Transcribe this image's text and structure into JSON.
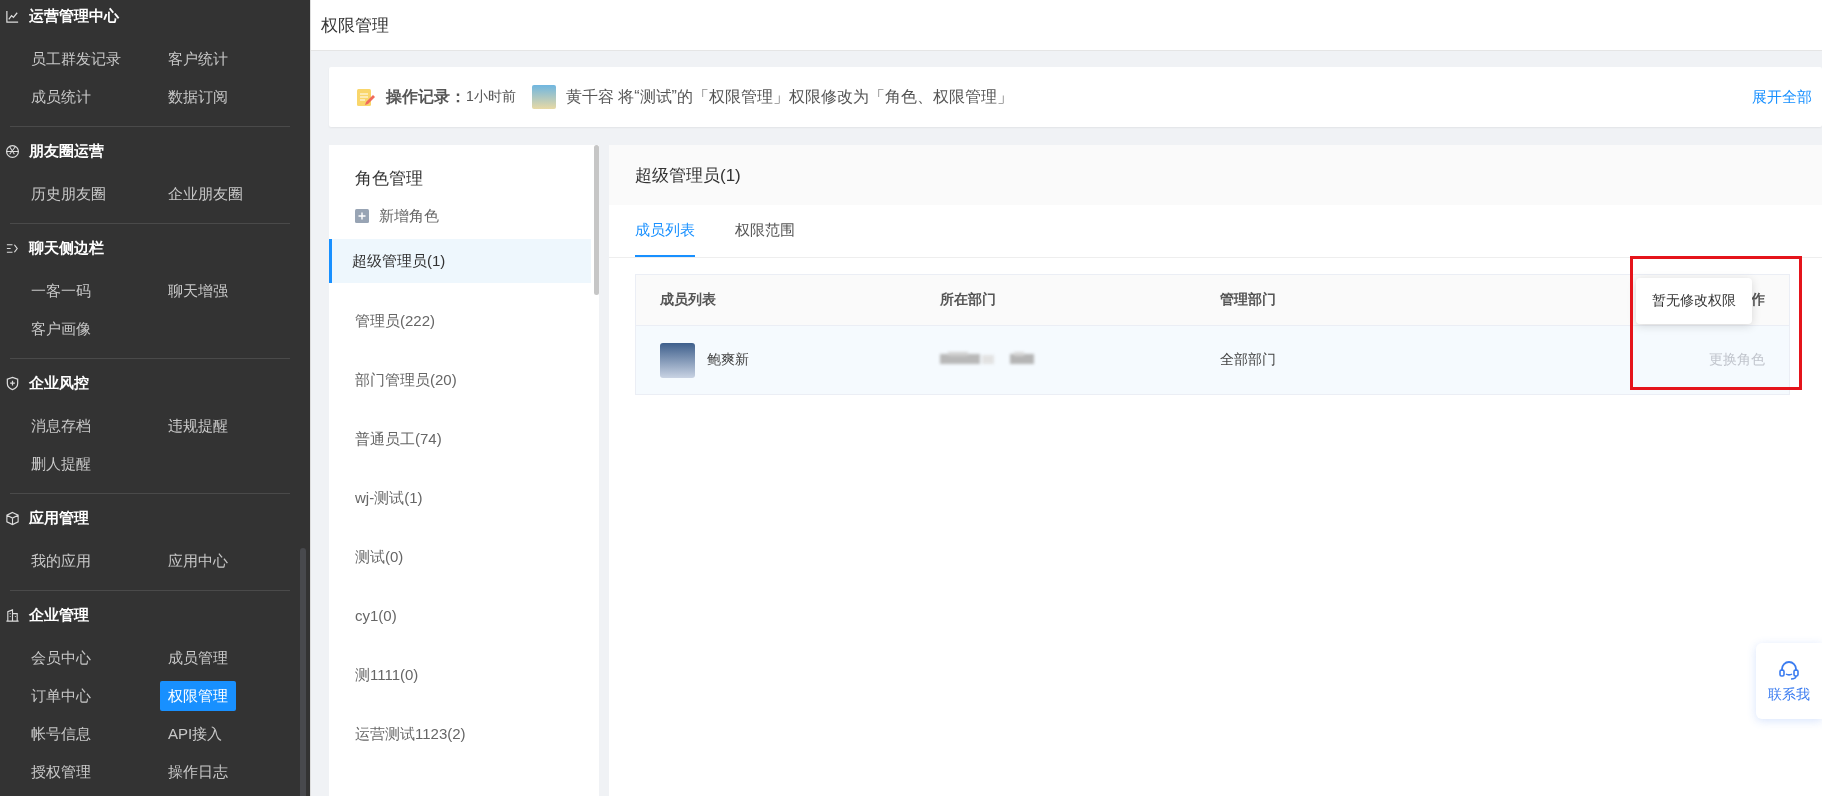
{
  "sidebar": {
    "groups": [
      {
        "title": "运营管理中心",
        "items": [
          {
            "label": "员工群发记录",
            "selected": false
          },
          {
            "label": "客户统计",
            "selected": false
          },
          {
            "label": "成员统计",
            "selected": false
          },
          {
            "label": "数据订阅",
            "selected": false
          }
        ]
      },
      {
        "title": "朋友圈运营",
        "items": [
          {
            "label": "历史朋友圈",
            "selected": false
          },
          {
            "label": "企业朋友圈",
            "selected": false
          }
        ]
      },
      {
        "title": "聊天侧边栏",
        "items": [
          {
            "label": "一客一码",
            "selected": false
          },
          {
            "label": "聊天增强",
            "selected": false
          },
          {
            "label": "客户画像",
            "selected": false
          }
        ]
      },
      {
        "title": "企业风控",
        "items": [
          {
            "label": "消息存档",
            "selected": false
          },
          {
            "label": "违规提醒",
            "selected": false
          },
          {
            "label": "删人提醒",
            "selected": false
          }
        ]
      },
      {
        "title": "应用管理",
        "items": [
          {
            "label": "我的应用",
            "selected": false
          },
          {
            "label": "应用中心",
            "selected": false
          }
        ]
      },
      {
        "title": "企业管理",
        "items": [
          {
            "label": "会员中心",
            "selected": false
          },
          {
            "label": "成员管理",
            "selected": false
          },
          {
            "label": "订单中心",
            "selected": false
          },
          {
            "label": "权限管理",
            "selected": true
          },
          {
            "label": "帐号信息",
            "selected": false
          },
          {
            "label": "API接入",
            "selected": false
          },
          {
            "label": "授权管理",
            "selected": false
          },
          {
            "label": "操作日志",
            "selected": false
          }
        ]
      }
    ]
  },
  "header": {
    "title": "权限管理"
  },
  "log": {
    "label": "操作记录：",
    "time": "1小时前",
    "message": "黄千容 将“测试”的「权限管理」权限修改为「角色、权限管理」",
    "expand_link": "展开全部"
  },
  "roles": {
    "title": "角色管理",
    "add_button": "新增角色",
    "items": [
      {
        "label": "超级管理员(1)",
        "selected": true
      },
      {
        "label": "管理员(222)",
        "selected": false
      },
      {
        "label": "部门管理员(20)",
        "selected": false
      },
      {
        "label": "普通员工(74)",
        "selected": false
      },
      {
        "label": "wj-测试(1)",
        "selected": false
      },
      {
        "label": "测试(0)",
        "selected": false
      },
      {
        "label": "cy1(0)",
        "selected": false
      },
      {
        "label": "测1111(0)",
        "selected": false
      },
      {
        "label": "运营测试1123(2)",
        "selected": false
      }
    ]
  },
  "detail": {
    "title": "超级管理员(1)",
    "tabs": [
      {
        "label": "成员列表",
        "selected": true
      },
      {
        "label": "权限范围",
        "selected": false
      }
    ],
    "table": {
      "columns": [
        "成员列表",
        "所在部门",
        "管理部门",
        "作"
      ],
      "rows": [
        {
          "name": "鲍爽新",
          "managed_department": "全部部门",
          "action": {
            "label": "更换角色",
            "disabled": true
          }
        }
      ]
    },
    "tooltip": "暂无修改权限"
  },
  "contact_button": "联系我"
}
